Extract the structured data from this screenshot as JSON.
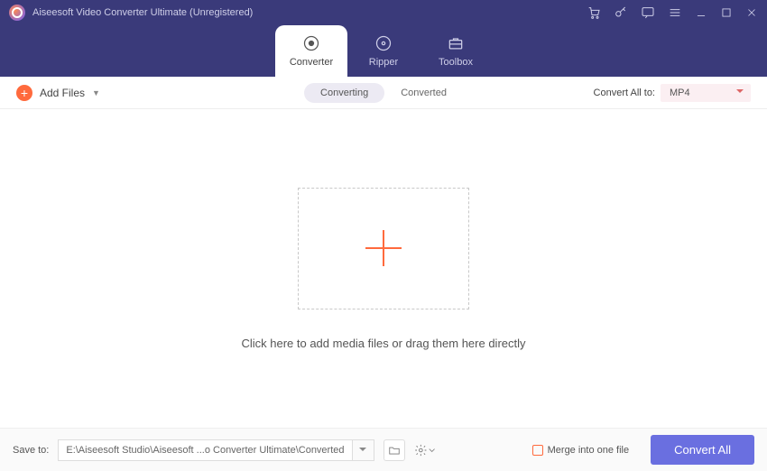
{
  "header": {
    "title": "Aiseesoft Video Converter Ultimate (Unregistered)",
    "tabs": [
      {
        "label": "Converter",
        "icon": "target-icon",
        "active": true
      },
      {
        "label": "Ripper",
        "icon": "disc-icon",
        "active": false
      },
      {
        "label": "Toolbox",
        "icon": "briefcase-icon",
        "active": false
      }
    ]
  },
  "toolbar": {
    "add_files_label": "Add Files",
    "segments": [
      {
        "label": "Converting",
        "active": true
      },
      {
        "label": "Converted",
        "active": false
      }
    ],
    "convert_all_label": "Convert All to:",
    "format_selected": "MP4"
  },
  "main": {
    "hint": "Click here to add media files or drag them here directly"
  },
  "footer": {
    "save_to_label": "Save to:",
    "save_path": "E:\\Aiseesoft Studio\\Aiseesoft ...o Converter Ultimate\\Converted",
    "merge_label": "Merge into one file",
    "convert_all_button": "Convert All"
  }
}
